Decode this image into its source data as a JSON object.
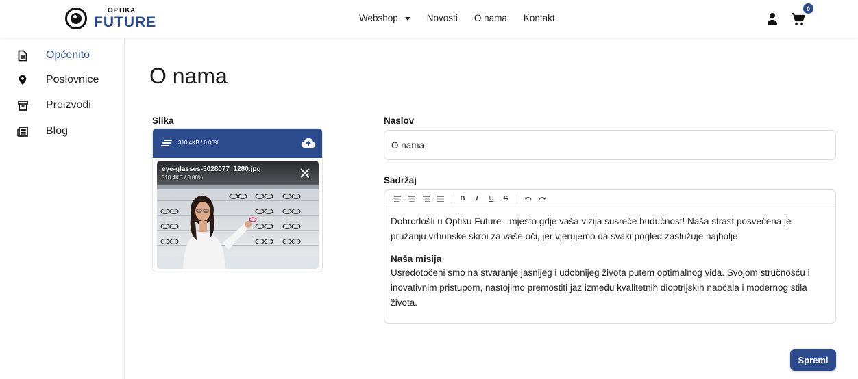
{
  "header": {
    "logo_top": "OPTIKA",
    "logo_bottom": "FUTURE",
    "nav": [
      {
        "label": "Webshop",
        "has_dropdown": true
      },
      {
        "label": "Novosti"
      },
      {
        "label": "O nama"
      },
      {
        "label": "Kontakt"
      }
    ],
    "cart_count": "0",
    "icons": {
      "user": "user-icon",
      "cart": "cart-icon",
      "logo": "eye-logo-icon"
    }
  },
  "sidebar": {
    "items": [
      {
        "label": "Općenito",
        "icon": "document-icon",
        "active": true
      },
      {
        "label": "Poslovnice",
        "icon": "location-pin-icon",
        "active": false
      },
      {
        "label": "Proizvodi",
        "icon": "archive-box-icon",
        "active": false
      },
      {
        "label": "Blog",
        "icon": "newspaper-icon",
        "active": false
      }
    ]
  },
  "main": {
    "title": "O nama",
    "image_label": "Slika",
    "upload": {
      "summary": "310.4KB / 0.00%",
      "file_name": "eye-glasses-5028077_1280.jpg",
      "file_size": "310.4KB / 0.00%"
    },
    "title_label": "Naslov",
    "title_value": "O nama",
    "content_label": "Sadržaj",
    "content": {
      "intro": "Dobrodošli u Optiku Future - mjesto gdje vaša vizija susreće budućnost! Naša strast posvećena je pružanju vrhunske skrbi za vaše oči, jer vjerujemo da svaki pogled zaslužuje najbolje.",
      "heading": "Naša misija",
      "mission": "Usredotočeni smo na stvaranje jasnijeg i udobnijeg života putem optimalnog vida. Svojom stručnošću i inovativnim pristupom, nastojimo premostiti jaz između kvalitetnih dioptrijskih naočala i modernog stila života."
    },
    "toolbar": [
      "align-left-icon",
      "align-center-icon",
      "align-right-icon",
      "align-justify-icon",
      "bold-icon",
      "italic-icon",
      "underline-icon",
      "strikethrough-icon",
      "undo-icon",
      "redo-icon"
    ],
    "toolbar_text": {
      "bold": "B",
      "italic": "I",
      "underline": "U",
      "strike": "S"
    },
    "save_label": "Spremi"
  },
  "colors": {
    "accent": "#2b4b8c"
  }
}
